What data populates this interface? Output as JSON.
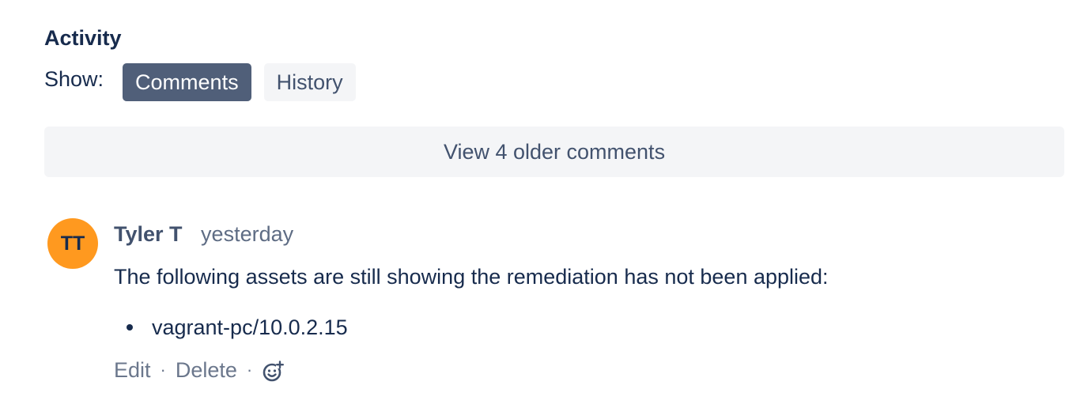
{
  "activity": {
    "heading": "Activity",
    "show_label": "Show:",
    "tabs": [
      {
        "label": "Comments",
        "active": true
      },
      {
        "label": "History",
        "active": false
      }
    ],
    "older_comments_label": "View 4 older comments"
  },
  "comment": {
    "avatar_initials": "TT",
    "avatar_color": "#ff991f",
    "author": "Tyler T",
    "timestamp": "yesterday",
    "text": "The following assets are still showing the remediation has not been applied:",
    "assets": [
      "vagrant-pc/10.0.2.15"
    ],
    "actions": {
      "edit_label": "Edit",
      "separator": "·",
      "delete_label": "Delete",
      "reaction_icon": "add-reaction-icon"
    }
  }
}
